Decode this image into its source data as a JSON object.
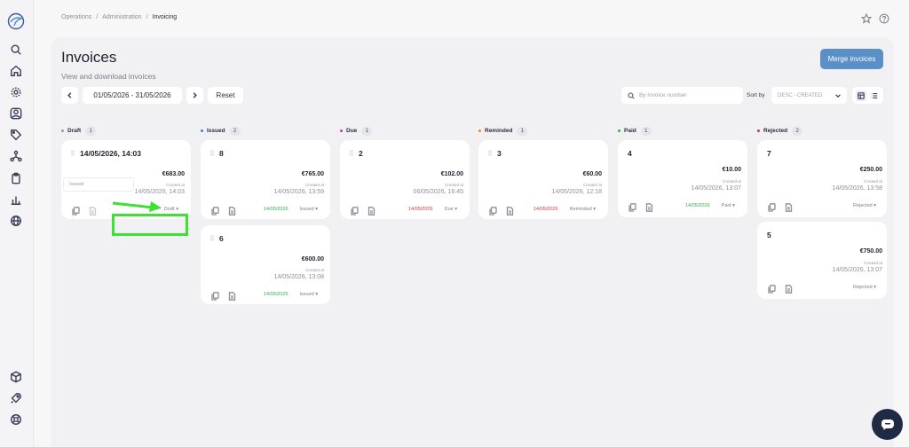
{
  "breadcrumb": {
    "items": [
      "Operations",
      "Administration",
      "Invoicing"
    ]
  },
  "page": {
    "title": "Invoices",
    "subtitle": "View and download invoices"
  },
  "toolbar": {
    "date_range": "01/05/2026 - 31/05/2026",
    "reset_label": "Reset",
    "search_placeholder": "By invoice number",
    "sort_label": "Sort by",
    "sort_value": "DESC - CREATED",
    "merge_label": "Merge invoices"
  },
  "colors": {
    "accent": "#5b8fc7",
    "highlight": "#3de033",
    "due_green": "#2fb14a",
    "due_red": "#e0323c",
    "dot_draft": "#9a9ca5",
    "dot_issued": "#4a7ad0",
    "dot_due": "#b03ad0",
    "dot_reminded": "#e8842c",
    "dot_paid": "#2fb14a",
    "dot_rejected": "#e0323c"
  },
  "columns": [
    {
      "title": "Draft",
      "count": "1",
      "cards": [
        {
          "number": "14/05/2026, 14:03",
          "amount": "€683.00",
          "created_label": "Created at",
          "created": "14/05/2026, 14:03",
          "due": "",
          "status": "Draft"
        }
      ]
    },
    {
      "title": "Issued",
      "count": "2",
      "cards": [
        {
          "number": "8",
          "amount": "€765.00",
          "created_label": "Created at",
          "created": "14/05/2026, 13:59",
          "due": "14/05/2026",
          "status": "Issued"
        },
        {
          "number": "6",
          "amount": "€600.00",
          "created_label": "Created at",
          "created": "14/05/2026, 13:08",
          "due": "14/05/2026",
          "status": "Issued"
        }
      ]
    },
    {
      "title": "Due",
      "count": "1",
      "cards": [
        {
          "number": "2",
          "amount": "€102.00",
          "created_label": "Created at",
          "created": "06/05/2026, 16:45",
          "due": "14/05/2026",
          "status": "Due"
        }
      ]
    },
    {
      "title": "Reminded",
      "count": "1",
      "cards": [
        {
          "number": "3",
          "amount": "€60.00",
          "created_label": "Created at",
          "created": "14/05/2026, 12:18",
          "due": "14/05/2026",
          "status": "Reminded"
        }
      ]
    },
    {
      "title": "Paid",
      "count": "1",
      "cards": [
        {
          "number": "4",
          "amount": "€10.00",
          "created_label": "Created at",
          "created": "14/05/2026, 13:07",
          "due": "14/05/2026",
          "status": "Paid"
        }
      ]
    },
    {
      "title": "Rejected",
      "count": "2",
      "cards": [
        {
          "number": "7",
          "amount": "€250.00",
          "created_label": "Created at",
          "created": "14/05/2026, 13:58",
          "due": "",
          "status": "Rejected"
        },
        {
          "number": "5",
          "amount": "€750.00",
          "created_label": "Created at",
          "created": "14/05/2026, 13:07",
          "due": "",
          "status": "Rejected"
        }
      ]
    }
  ],
  "status_menu": {
    "option": "Issued"
  },
  "sidebar": {
    "icons": [
      "search-icon",
      "home-icon",
      "gear-icon",
      "user-icon",
      "tag-icon",
      "network-icon",
      "clipboard-icon",
      "chart-icon",
      "globe-icon",
      "box-icon",
      "rocket-icon",
      "lifebuoy-icon"
    ]
  }
}
